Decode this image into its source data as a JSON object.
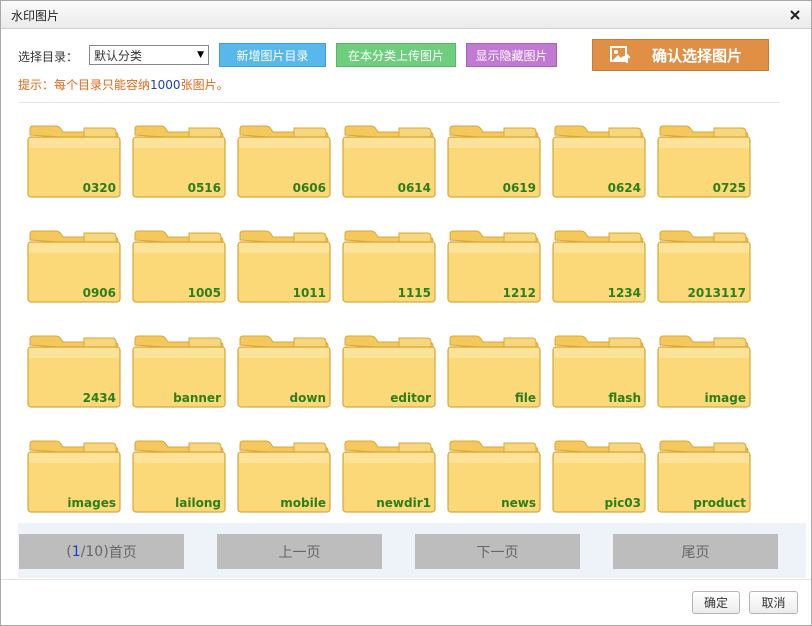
{
  "dialog": {
    "title": "水印图片",
    "close_icon": "close-icon"
  },
  "toolbar": {
    "dir_label": "选择目录：",
    "dir_selected": "默认分类",
    "new_dir_button": "新增图片目录",
    "upload_button": "在本分类上传图片",
    "show_hidden_button": "显示隐藏图片",
    "confirm_button": "确认选择图片",
    "confirm_icon": "image-upload-icon"
  },
  "hint": {
    "prefix": "提示：每个目录只能容纳",
    "number": "1000",
    "suffix": "张图片。"
  },
  "folders": [
    "0320",
    "0516",
    "0606",
    "0614",
    "0619",
    "0624",
    "0725",
    "0906",
    "1005",
    "1011",
    "1115",
    "1212",
    "1234",
    "2013117",
    "2434",
    "banner",
    "down",
    "editor",
    "file",
    "flash",
    "image",
    "images",
    "lailong",
    "mobile",
    "newdir1",
    "news",
    "pic03",
    "product"
  ],
  "colors": {
    "folder_fill": "#fbd878",
    "folder_label": "#2d7e1c",
    "accent_orange": "#e08f45"
  },
  "pager": {
    "open_paren": "(",
    "current": "1",
    "total": "/10)",
    "first_label": " 首页",
    "prev_label": "上一页",
    "next_label": "下一页",
    "last_label": "尾页"
  },
  "footer": {
    "ok_button": "确定",
    "cancel_button": "取消"
  }
}
